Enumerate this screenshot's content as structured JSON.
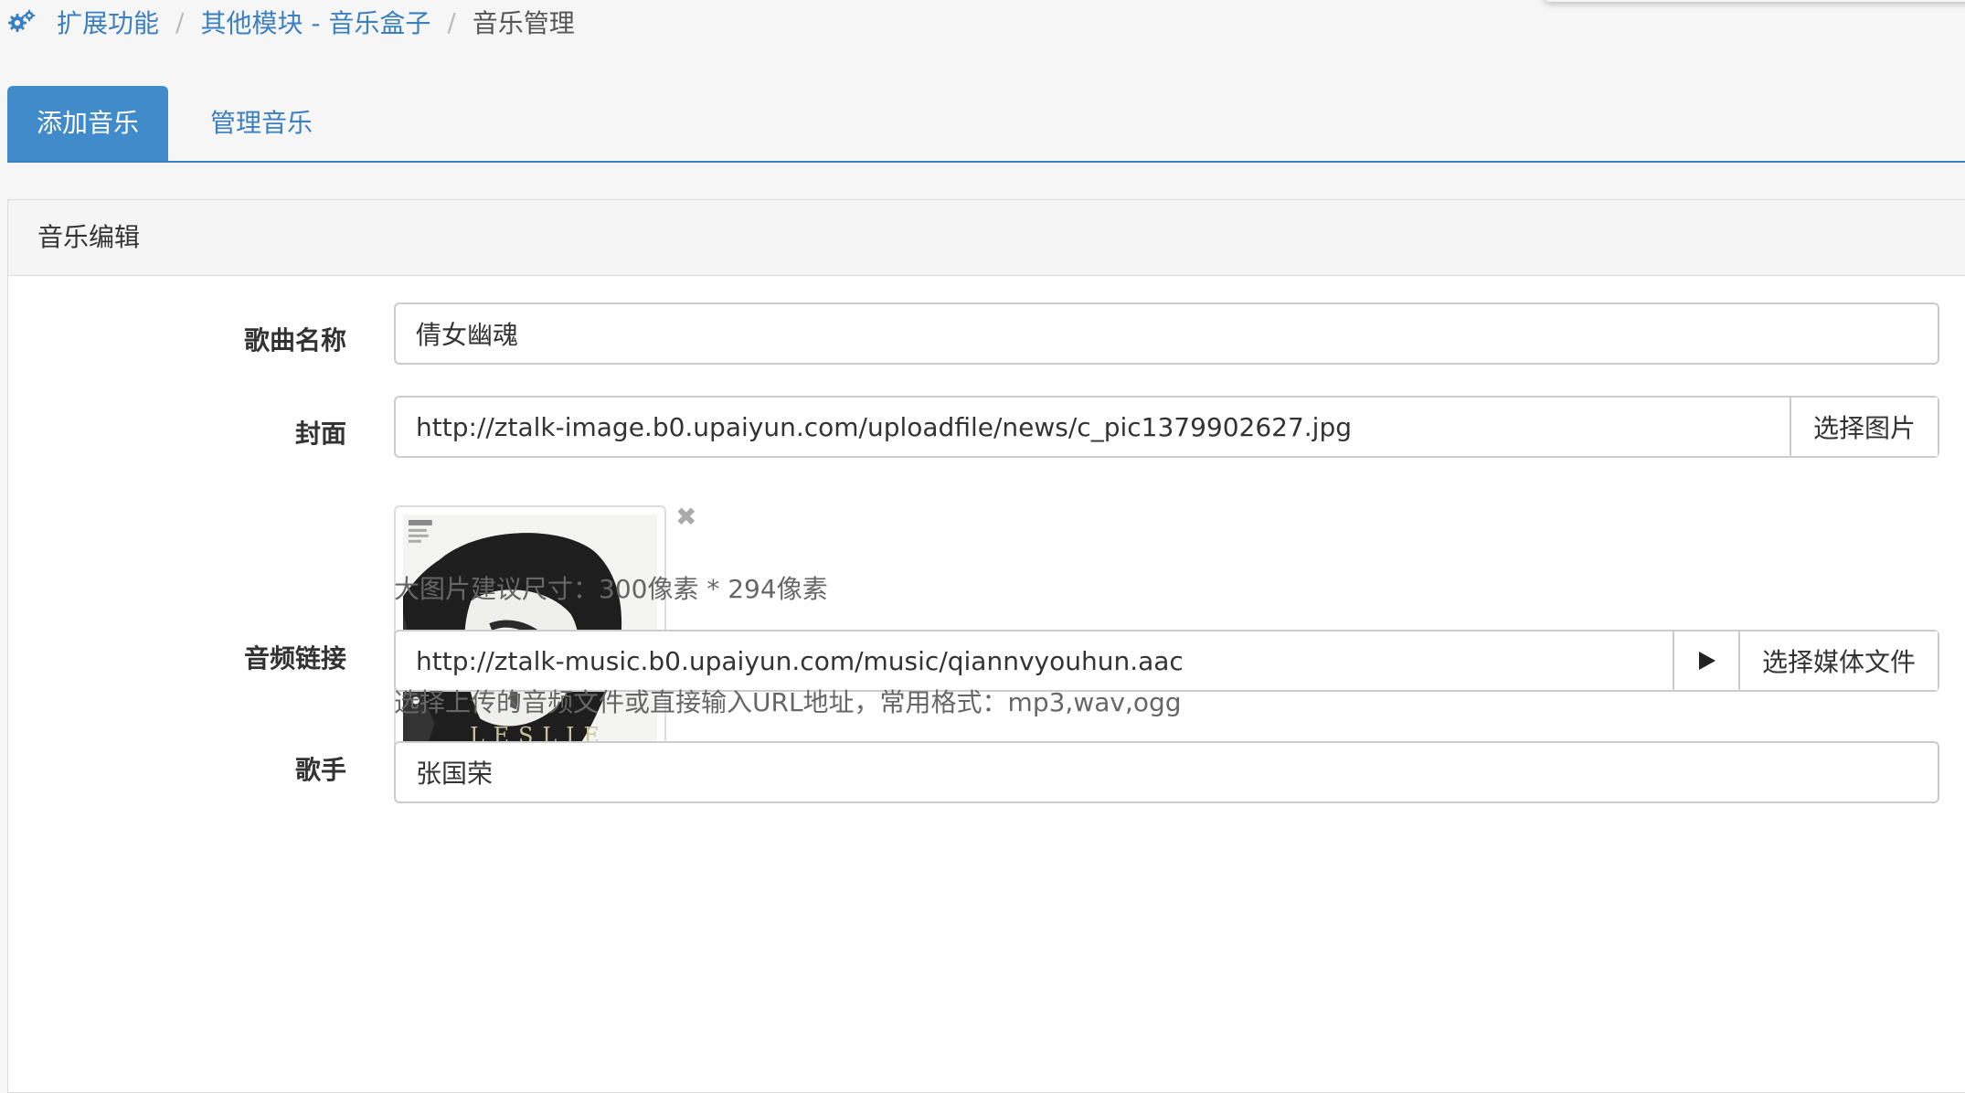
{
  "breadcrumb": {
    "icon": "gears-icon",
    "items": [
      "扩展功能",
      "其他模块 - 音乐盒子"
    ],
    "separator": "/",
    "current": "音乐管理"
  },
  "tabs": [
    {
      "label": "添加音乐",
      "active": true
    },
    {
      "label": "管理音乐",
      "active": false
    }
  ],
  "panel": {
    "title": "音乐编辑"
  },
  "form": {
    "song_name": {
      "label": "歌曲名称",
      "value": "倩女幽魂"
    },
    "cover": {
      "label": "封面",
      "value": "http://ztalk-image.b0.upaiyun.com/uploadfile/news/c_pic1379902627.jpg",
      "button": "选择图片",
      "image_text": "LESLIE",
      "remove_icon": "close-icon",
      "help": "大图片建议尺寸：300像素 * 294像素"
    },
    "audio": {
      "label": "音频链接",
      "value": "http://ztalk-music.b0.upaiyun.com/music/qiannvyouhun.aac",
      "play_icon": "play-icon",
      "button": "选择媒体文件",
      "help": "选择上传的音频文件或直接输入URL地址，常用格式：mp3,wav,ogg"
    },
    "singer": {
      "label": "歌手",
      "value": "张国荣"
    }
  },
  "colors": {
    "link": "#3a7fc1",
    "tab_active_bg": "#428bca"
  }
}
